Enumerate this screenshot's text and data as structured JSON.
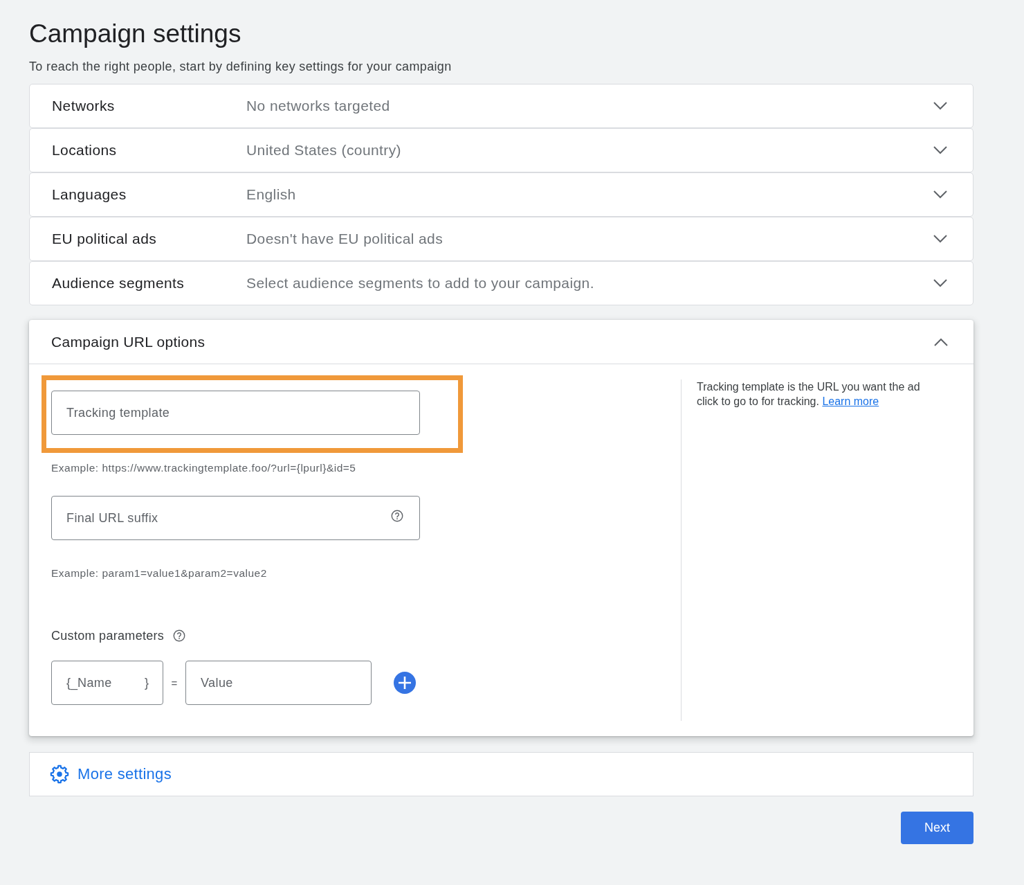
{
  "page": {
    "title": "Campaign settings",
    "subtitle": "To reach the right people, start by defining key settings for your campaign"
  },
  "sections": [
    {
      "label": "Networks",
      "summary": "No networks targeted",
      "expanded": false
    },
    {
      "label": "Locations",
      "summary": "United States (country)",
      "expanded": false
    },
    {
      "label": "Languages",
      "summary": "English",
      "expanded": false
    },
    {
      "label": "EU political ads",
      "summary": "Doesn't have EU political ads",
      "expanded": false
    },
    {
      "label": "Audience segments",
      "summary": "Select audience segments to add to your campaign.",
      "expanded": false
    }
  ],
  "url_options": {
    "title": "Campaign URL options",
    "expanded": true,
    "tracking_template": {
      "placeholder": "Tracking template",
      "highlighted": true,
      "example": "Example: https://www.trackingtemplate.foo/?url={lpurl}&id=5"
    },
    "final_url_suffix": {
      "placeholder": "Final URL suffix",
      "example": "Example: param1=value1&param2=value2"
    },
    "custom_parameters": {
      "label": "Custom parameters",
      "name_field": {
        "prefix": "{_",
        "placeholder": "Name",
        "suffix": "}"
      },
      "equals": "=",
      "value_field": {
        "placeholder": "Value"
      }
    },
    "help": {
      "text": "Tracking template is the URL you want the ad click to go to for tracking.",
      "link": "Learn more"
    }
  },
  "more_settings": {
    "label": "More settings"
  },
  "next_button": {
    "label": "Next"
  }
}
